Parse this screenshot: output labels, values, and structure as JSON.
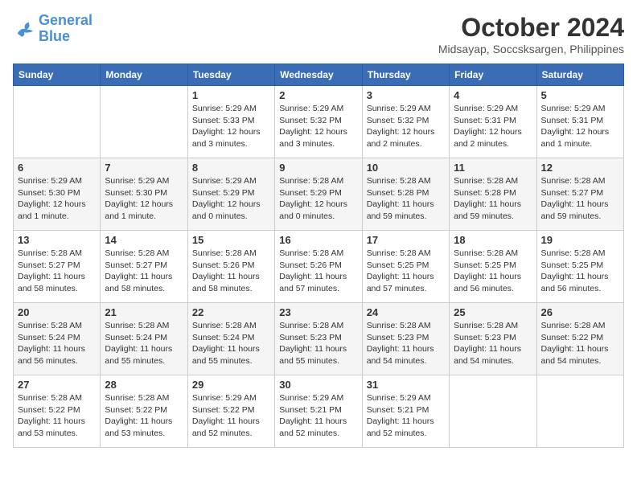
{
  "header": {
    "logo_line1": "General",
    "logo_line2": "Blue",
    "month": "October 2024",
    "location": "Midsayap, Soccsksargen, Philippines"
  },
  "weekdays": [
    "Sunday",
    "Monday",
    "Tuesday",
    "Wednesday",
    "Thursday",
    "Friday",
    "Saturday"
  ],
  "weeks": [
    [
      {
        "day": null
      },
      {
        "day": null
      },
      {
        "day": "1",
        "sunrise": "Sunrise: 5:29 AM",
        "sunset": "Sunset: 5:33 PM",
        "daylight": "Daylight: 12 hours and 3 minutes."
      },
      {
        "day": "2",
        "sunrise": "Sunrise: 5:29 AM",
        "sunset": "Sunset: 5:32 PM",
        "daylight": "Daylight: 12 hours and 3 minutes."
      },
      {
        "day": "3",
        "sunrise": "Sunrise: 5:29 AM",
        "sunset": "Sunset: 5:32 PM",
        "daylight": "Daylight: 12 hours and 2 minutes."
      },
      {
        "day": "4",
        "sunrise": "Sunrise: 5:29 AM",
        "sunset": "Sunset: 5:31 PM",
        "daylight": "Daylight: 12 hours and 2 minutes."
      },
      {
        "day": "5",
        "sunrise": "Sunrise: 5:29 AM",
        "sunset": "Sunset: 5:31 PM",
        "daylight": "Daylight: 12 hours and 1 minute."
      }
    ],
    [
      {
        "day": "6",
        "sunrise": "Sunrise: 5:29 AM",
        "sunset": "Sunset: 5:30 PM",
        "daylight": "Daylight: 12 hours and 1 minute."
      },
      {
        "day": "7",
        "sunrise": "Sunrise: 5:29 AM",
        "sunset": "Sunset: 5:30 PM",
        "daylight": "Daylight: 12 hours and 1 minute."
      },
      {
        "day": "8",
        "sunrise": "Sunrise: 5:29 AM",
        "sunset": "Sunset: 5:29 PM",
        "daylight": "Daylight: 12 hours and 0 minutes."
      },
      {
        "day": "9",
        "sunrise": "Sunrise: 5:28 AM",
        "sunset": "Sunset: 5:29 PM",
        "daylight": "Daylight: 12 hours and 0 minutes."
      },
      {
        "day": "10",
        "sunrise": "Sunrise: 5:28 AM",
        "sunset": "Sunset: 5:28 PM",
        "daylight": "Daylight: 11 hours and 59 minutes."
      },
      {
        "day": "11",
        "sunrise": "Sunrise: 5:28 AM",
        "sunset": "Sunset: 5:28 PM",
        "daylight": "Daylight: 11 hours and 59 minutes."
      },
      {
        "day": "12",
        "sunrise": "Sunrise: 5:28 AM",
        "sunset": "Sunset: 5:27 PM",
        "daylight": "Daylight: 11 hours and 59 minutes."
      }
    ],
    [
      {
        "day": "13",
        "sunrise": "Sunrise: 5:28 AM",
        "sunset": "Sunset: 5:27 PM",
        "daylight": "Daylight: 11 hours and 58 minutes."
      },
      {
        "day": "14",
        "sunrise": "Sunrise: 5:28 AM",
        "sunset": "Sunset: 5:27 PM",
        "daylight": "Daylight: 11 hours and 58 minutes."
      },
      {
        "day": "15",
        "sunrise": "Sunrise: 5:28 AM",
        "sunset": "Sunset: 5:26 PM",
        "daylight": "Daylight: 11 hours and 58 minutes."
      },
      {
        "day": "16",
        "sunrise": "Sunrise: 5:28 AM",
        "sunset": "Sunset: 5:26 PM",
        "daylight": "Daylight: 11 hours and 57 minutes."
      },
      {
        "day": "17",
        "sunrise": "Sunrise: 5:28 AM",
        "sunset": "Sunset: 5:25 PM",
        "daylight": "Daylight: 11 hours and 57 minutes."
      },
      {
        "day": "18",
        "sunrise": "Sunrise: 5:28 AM",
        "sunset": "Sunset: 5:25 PM",
        "daylight": "Daylight: 11 hours and 56 minutes."
      },
      {
        "day": "19",
        "sunrise": "Sunrise: 5:28 AM",
        "sunset": "Sunset: 5:25 PM",
        "daylight": "Daylight: 11 hours and 56 minutes."
      }
    ],
    [
      {
        "day": "20",
        "sunrise": "Sunrise: 5:28 AM",
        "sunset": "Sunset: 5:24 PM",
        "daylight": "Daylight: 11 hours and 56 minutes."
      },
      {
        "day": "21",
        "sunrise": "Sunrise: 5:28 AM",
        "sunset": "Sunset: 5:24 PM",
        "daylight": "Daylight: 11 hours and 55 minutes."
      },
      {
        "day": "22",
        "sunrise": "Sunrise: 5:28 AM",
        "sunset": "Sunset: 5:24 PM",
        "daylight": "Daylight: 11 hours and 55 minutes."
      },
      {
        "day": "23",
        "sunrise": "Sunrise: 5:28 AM",
        "sunset": "Sunset: 5:23 PM",
        "daylight": "Daylight: 11 hours and 55 minutes."
      },
      {
        "day": "24",
        "sunrise": "Sunrise: 5:28 AM",
        "sunset": "Sunset: 5:23 PM",
        "daylight": "Daylight: 11 hours and 54 minutes."
      },
      {
        "day": "25",
        "sunrise": "Sunrise: 5:28 AM",
        "sunset": "Sunset: 5:23 PM",
        "daylight": "Daylight: 11 hours and 54 minutes."
      },
      {
        "day": "26",
        "sunrise": "Sunrise: 5:28 AM",
        "sunset": "Sunset: 5:22 PM",
        "daylight": "Daylight: 11 hours and 54 minutes."
      }
    ],
    [
      {
        "day": "27",
        "sunrise": "Sunrise: 5:28 AM",
        "sunset": "Sunset: 5:22 PM",
        "daylight": "Daylight: 11 hours and 53 minutes."
      },
      {
        "day": "28",
        "sunrise": "Sunrise: 5:28 AM",
        "sunset": "Sunset: 5:22 PM",
        "daylight": "Daylight: 11 hours and 53 minutes."
      },
      {
        "day": "29",
        "sunrise": "Sunrise: 5:29 AM",
        "sunset": "Sunset: 5:22 PM",
        "daylight": "Daylight: 11 hours and 52 minutes."
      },
      {
        "day": "30",
        "sunrise": "Sunrise: 5:29 AM",
        "sunset": "Sunset: 5:21 PM",
        "daylight": "Daylight: 11 hours and 52 minutes."
      },
      {
        "day": "31",
        "sunrise": "Sunrise: 5:29 AM",
        "sunset": "Sunset: 5:21 PM",
        "daylight": "Daylight: 11 hours and 52 minutes."
      },
      {
        "day": null
      },
      {
        "day": null
      }
    ]
  ]
}
